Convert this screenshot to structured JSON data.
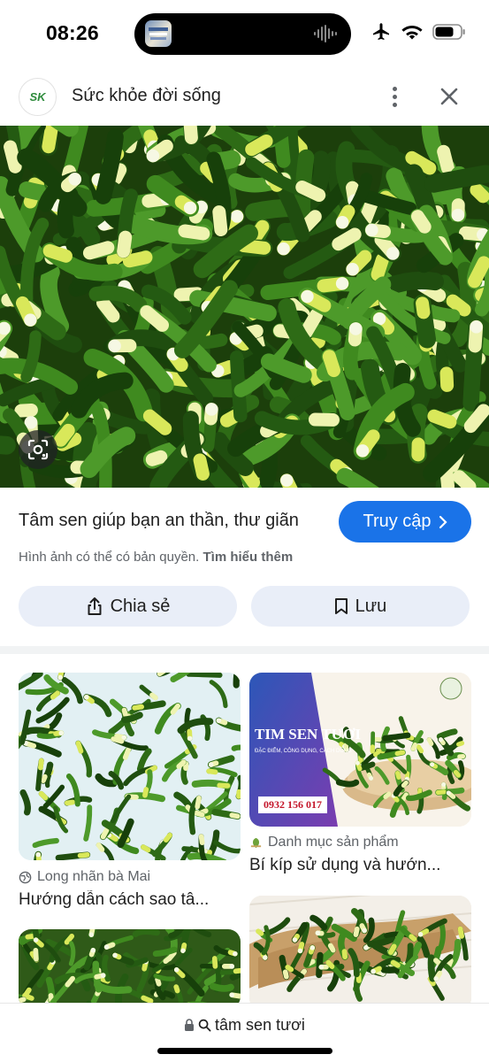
{
  "status": {
    "time": "08:26",
    "icons": [
      "airplane-icon",
      "wifi-icon",
      "battery-icon"
    ]
  },
  "header": {
    "logo_text": "SK",
    "site_name": "Sức khỏe đời sống",
    "icons": [
      "more-vert-icon",
      "close-icon"
    ]
  },
  "hero": {
    "alt": "lotus embryo sprouts",
    "lens_icon": "lens-icon"
  },
  "result": {
    "title": "Tâm sen giúp bạn an thần, thư giãn",
    "visit_label": "Truy cập",
    "copyright_text": "Hình ảnh có thể có bản quyền.",
    "learn_more": "Tìm hiểu thêm",
    "share_label": "Chia sẻ",
    "save_label": "Lưu"
  },
  "related": [
    {
      "source": "Long nhãn bà Mai",
      "title": "Hướng dẫn cách sao tâ...",
      "source_icon": "globe-icon"
    },
    {
      "source": "Danh mục sản phẩm",
      "title": "Bí kíp sử dụng và hướn...",
      "source_icon": "site-favicon-icon",
      "promo": {
        "title": "TIM SEN TƯƠI",
        "subtitle": "ĐẶC ĐIỂM, CÔNG DỤNG, CÁCH DÙNG",
        "phone": "0932 156 017"
      }
    },
    {
      "source": "",
      "title": ""
    },
    {
      "source": "",
      "title": ""
    }
  ],
  "bottom": {
    "url_text": "tâm sen tươi",
    "icons": [
      "lock-icon",
      "search-icon"
    ]
  },
  "colors": {
    "accent": "#1a73e8",
    "button_bg": "#e9eef8",
    "leaf_green": "#2d5a17",
    "sprout_yellow": "#d9e85a"
  }
}
